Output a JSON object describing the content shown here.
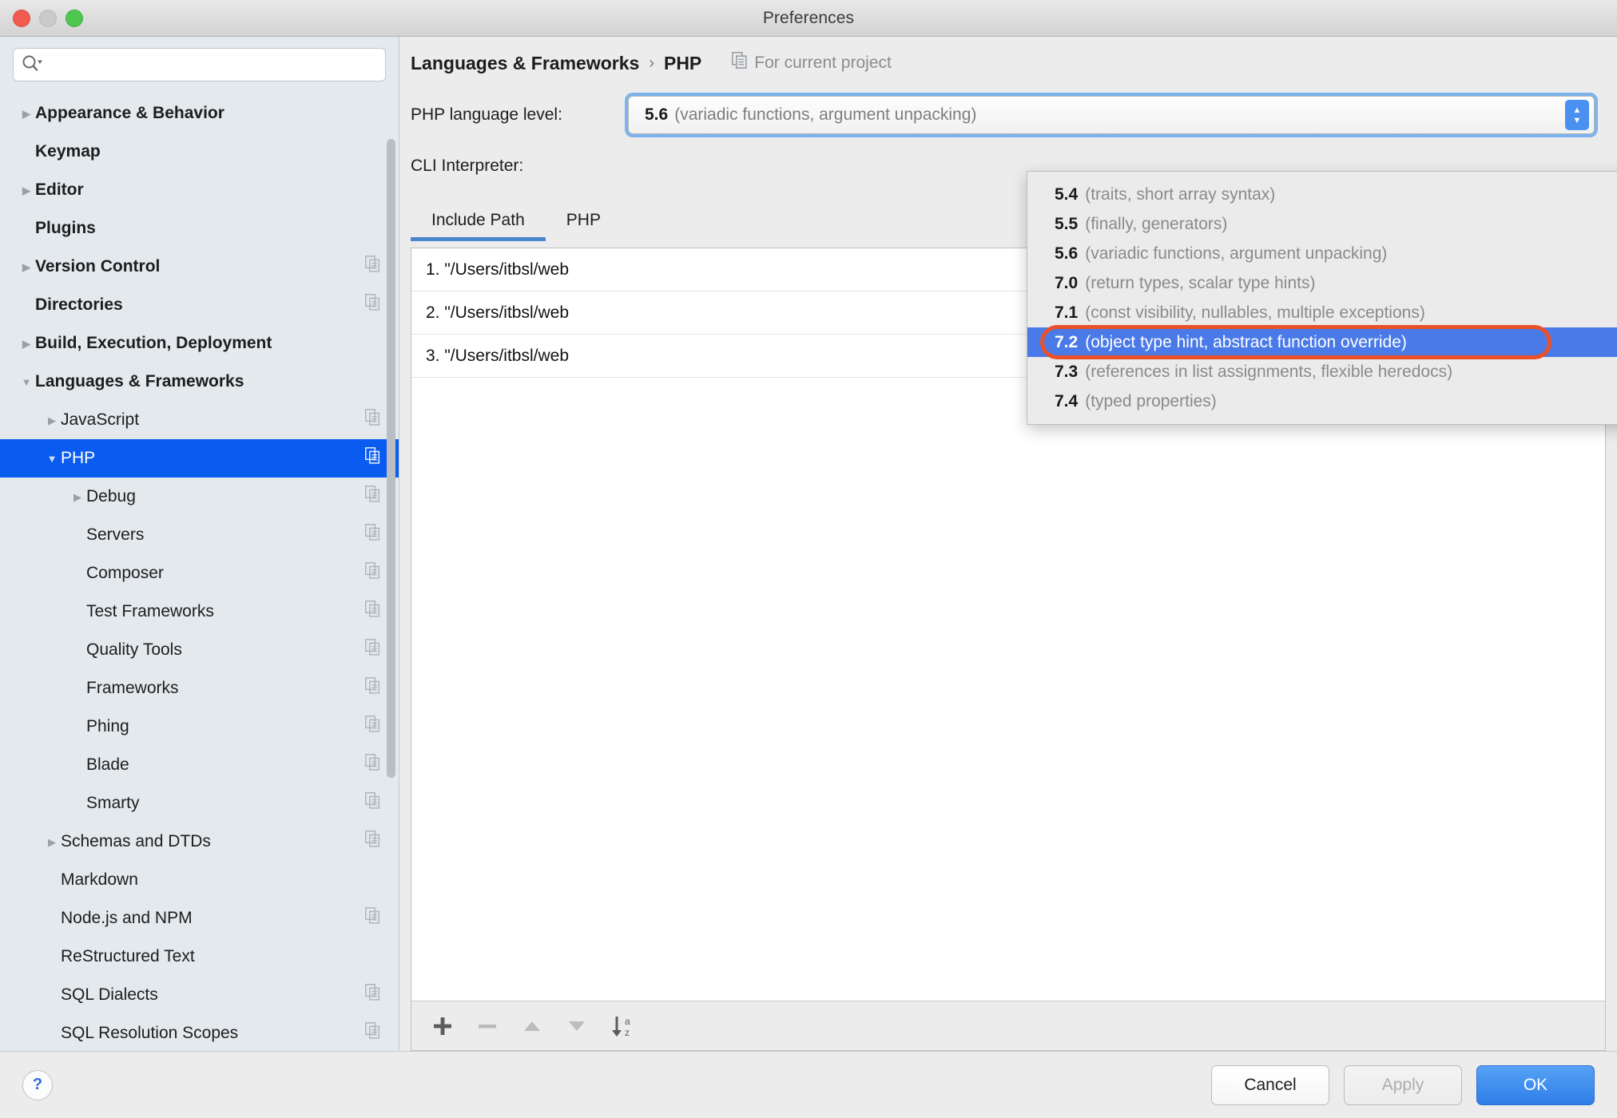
{
  "window": {
    "title": "Preferences"
  },
  "search": {
    "value": "",
    "placeholder": "",
    "icon": "search-icon"
  },
  "sidebar": {
    "items": [
      {
        "label": "Appearance & Behavior",
        "twisty": "collapsed",
        "level": 0,
        "bold": true,
        "badge": false,
        "selected": false
      },
      {
        "label": "Keymap",
        "twisty": "none",
        "level": 0,
        "bold": true,
        "badge": false,
        "selected": false
      },
      {
        "label": "Editor",
        "twisty": "collapsed",
        "level": 0,
        "bold": true,
        "badge": false,
        "selected": false
      },
      {
        "label": "Plugins",
        "twisty": "none",
        "level": 0,
        "bold": true,
        "badge": false,
        "selected": false
      },
      {
        "label": "Version Control",
        "twisty": "collapsed",
        "level": 0,
        "bold": true,
        "badge": true,
        "selected": false
      },
      {
        "label": "Directories",
        "twisty": "none",
        "level": 0,
        "bold": true,
        "badge": true,
        "selected": false
      },
      {
        "label": "Build, Execution, Deployment",
        "twisty": "collapsed",
        "level": 0,
        "bold": true,
        "badge": false,
        "selected": false
      },
      {
        "label": "Languages & Frameworks",
        "twisty": "expanded",
        "level": 0,
        "bold": true,
        "badge": false,
        "selected": false
      },
      {
        "label": "JavaScript",
        "twisty": "collapsed",
        "level": 1,
        "bold": false,
        "badge": true,
        "selected": false
      },
      {
        "label": "PHP",
        "twisty": "expanded",
        "level": 1,
        "bold": false,
        "badge": true,
        "selected": true
      },
      {
        "label": "Debug",
        "twisty": "collapsed",
        "level": 2,
        "bold": false,
        "badge": true,
        "selected": false
      },
      {
        "label": "Servers",
        "twisty": "none",
        "level": 2,
        "bold": false,
        "badge": true,
        "selected": false
      },
      {
        "label": "Composer",
        "twisty": "none",
        "level": 2,
        "bold": false,
        "badge": true,
        "selected": false
      },
      {
        "label": "Test Frameworks",
        "twisty": "none",
        "level": 2,
        "bold": false,
        "badge": true,
        "selected": false
      },
      {
        "label": "Quality Tools",
        "twisty": "none",
        "level": 2,
        "bold": false,
        "badge": true,
        "selected": false
      },
      {
        "label": "Frameworks",
        "twisty": "none",
        "level": 2,
        "bold": false,
        "badge": true,
        "selected": false
      },
      {
        "label": "Phing",
        "twisty": "none",
        "level": 2,
        "bold": false,
        "badge": true,
        "selected": false
      },
      {
        "label": "Blade",
        "twisty": "none",
        "level": 2,
        "bold": false,
        "badge": true,
        "selected": false
      },
      {
        "label": "Smarty",
        "twisty": "none",
        "level": 2,
        "bold": false,
        "badge": true,
        "selected": false
      },
      {
        "label": "Schemas and DTDs",
        "twisty": "collapsed",
        "level": 1,
        "bold": false,
        "badge": true,
        "selected": false
      },
      {
        "label": "Markdown",
        "twisty": "none",
        "level": 1,
        "bold": false,
        "badge": false,
        "selected": false
      },
      {
        "label": "Node.js and NPM",
        "twisty": "none",
        "level": 1,
        "bold": false,
        "badge": true,
        "selected": false
      },
      {
        "label": "ReStructured Text",
        "twisty": "none",
        "level": 1,
        "bold": false,
        "badge": false,
        "selected": false
      },
      {
        "label": "SQL Dialects",
        "twisty": "none",
        "level": 1,
        "bold": false,
        "badge": true,
        "selected": false
      },
      {
        "label": "SQL Resolution Scopes",
        "twisty": "none",
        "level": 1,
        "bold": false,
        "badge": true,
        "selected": false
      }
    ]
  },
  "header": {
    "breadcrumb_root": "Languages & Frameworks",
    "breadcrumb_separator": "›",
    "breadcrumb_leaf": "PHP",
    "scope_label": "For current project",
    "scope_icon": "copy-scope-icon"
  },
  "form": {
    "language_level_label": "PHP language level:",
    "language_level_value_version": "5.6",
    "language_level_value_desc": "(variadic functions, argument unpacking)",
    "cli_interpreter_label": "CLI Interpreter:"
  },
  "dropdown": {
    "open": true,
    "options": [
      {
        "version": "5.4",
        "desc": "(traits, short array syntax)",
        "selected": false
      },
      {
        "version": "5.5",
        "desc": "(finally, generators)",
        "selected": false
      },
      {
        "version": "5.6",
        "desc": "(variadic functions, argument unpacking)",
        "selected": false
      },
      {
        "version": "7.0",
        "desc": "(return types, scalar type hints)",
        "selected": false
      },
      {
        "version": "7.1",
        "desc": "(const visibility, nullables, multiple exceptions)",
        "selected": false
      },
      {
        "version": "7.2",
        "desc": "(object type hint, abstract function override)",
        "selected": true
      },
      {
        "version": "7.3",
        "desc": "(references in list assignments, flexible heredocs)",
        "selected": false
      },
      {
        "version": "7.4",
        "desc": "(typed properties)",
        "selected": false
      }
    ],
    "annotation_color": "#e8512a",
    "highlight_color": "#4a7ae8"
  },
  "tabs": [
    {
      "label": "Include Path",
      "active": true
    },
    {
      "label": "PHP",
      "active": false
    }
  ],
  "include_path": {
    "rows": [
      {
        "text": "1. \"/Users/itbsl/web"
      },
      {
        "text": "2. \"/Users/itbsl/web"
      },
      {
        "text": "3. \"/Users/itbsl/web"
      }
    ],
    "toolbar": [
      {
        "name": "add-icon",
        "glyph": "+"
      },
      {
        "name": "remove-icon",
        "glyph": "–"
      },
      {
        "name": "move-up-icon",
        "glyph": "▲"
      },
      {
        "name": "move-down-icon",
        "glyph": "▼"
      },
      {
        "name": "sort-az-icon",
        "glyph": "↓az"
      }
    ]
  },
  "footer": {
    "help_label": "?",
    "cancel_label": "Cancel",
    "apply_label": "Apply",
    "ok_label": "OK",
    "ok_color": "#2f7ee8"
  }
}
